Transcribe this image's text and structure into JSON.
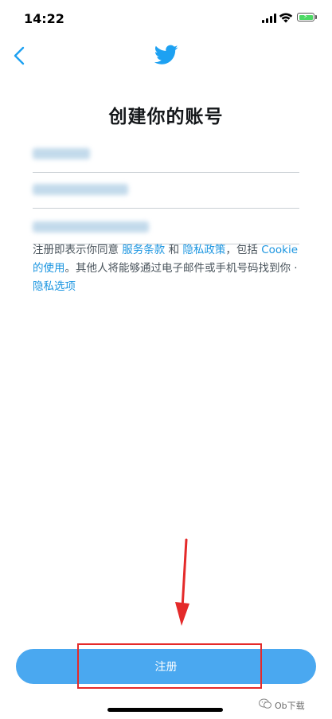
{
  "status_bar": {
    "time": "14:22"
  },
  "page": {
    "title": "创建你的账号"
  },
  "form": {
    "fields": [
      {
        "name": "name",
        "value": ""
      },
      {
        "name": "phone",
        "value": ""
      },
      {
        "name": "email",
        "value": ""
      }
    ]
  },
  "terms": {
    "prefix": "注册即表示你同意 ",
    "terms_link": "服务条款",
    "and": " 和 ",
    "privacy_link": "隐私政策",
    "including": "，包括 ",
    "cookie_link": "Cookie 的使用",
    "middle": "。其他人将能够通过电子邮件或手机号码找到你 · ",
    "privacy_options_link": "隐私选项"
  },
  "actions": {
    "signup_label": "注册"
  },
  "watermark": {
    "text": "Ob下载"
  },
  "colors": {
    "accent": "#1b95e0",
    "button": "#4aa8f0",
    "annotation": "#e42a2a"
  },
  "icons": {
    "back": "chevron-left-icon",
    "logo": "twitter-bird-icon"
  }
}
